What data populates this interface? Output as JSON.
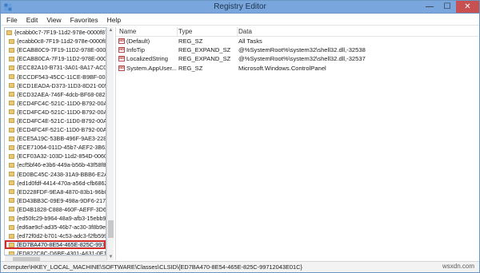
{
  "window": {
    "title": "Registry Editor"
  },
  "controls": {
    "minimize": "—",
    "maximize": "☐",
    "close": "✕"
  },
  "menu": [
    "File",
    "Edit",
    "View",
    "Favorites",
    "Help"
  ],
  "tree": {
    "items": [
      "{ecabb0c7-7F19-11d2-978e-0000f87",
      "{ecabb0c8-7F19-11d2-978e-0000f87",
      "{ECABB0C9-7F19-11D2-978E-0000F",
      "{ECABB0CA-7F19-11D2-978E-0000F",
      "{ECC82A10-B731-3A01-8A17-AC0D",
      "{ECCDF543-45CC-11CE-B9BF-0080",
      "{ECD1EADA-D373-11D3-8D21-0050",
      "{ECD32AEA-746F-4dcb-BF68-08275",
      "{ECD4FC4C-521C-11D0-B792-00A0",
      "{ECD4FC4D-521C-11D0-B792-00A0",
      "{ECD4FC4E-521C-11D0-B792-00A0",
      "{ECD4FC4F-521C-11D0-B792-00A0",
      "{ECE5A19C-53BB-496F-9AE3-2283F",
      "{ECE71064-011D-45b7-AEF2-3B626",
      "{ECF03A32-103D-11d2-854D-00600",
      "{ecf5bf46-e3b6-449a-b56b-43f58f8",
      "{ED0BC45C-2438-31A9-BBB6-E2A3",
      "{ed1d0fdf-4414-470a-a56d-cfb6862",
      "{ED228FDF-9EA8-4870-83b1-96b02",
      "{ED43BB3C-09E9-498a-9DF6-21772",
      "{ED4B1828-C888-460F-AEFF-3D63F",
      "{ed50fc29-b964-48a9-afb3-15ebb9f",
      "{ed6ae9cf-ad35-46b7-ac30-3f8b9e8",
      "{ed72f0d2-b701-4c53-adc3-f2fb599",
      "{ED7BA470-8E54-465E-825C-99712",
      "{ED822C8C-D6BE-4301-A631-0E141"
    ],
    "selected_index": 24
  },
  "list": {
    "headers": {
      "name": "Name",
      "type": "Type",
      "data": "Data"
    },
    "rows": [
      {
        "name": "(Default)",
        "type": "REG_SZ",
        "data": "All Tasks"
      },
      {
        "name": "InfoTip",
        "type": "REG_EXPAND_SZ",
        "data": "@%SystemRoot%\\system32\\shell32.dll,-32538"
      },
      {
        "name": "LocalizedString",
        "type": "REG_EXPAND_SZ",
        "data": "@%SystemRoot%\\system32\\shell32.dll,-32537"
      },
      {
        "name": "System.AppUser...",
        "type": "REG_SZ",
        "data": "Microsoft.Windows.ControlPanel"
      }
    ],
    "value_icon_text": "ab"
  },
  "statusbar": {
    "path": "Computer\\HKEY_LOCAL_MACHINE\\SOFTWARE\\Classes\\CLSID\\{ED7BA470-8E54-465E-825C-99712043E01C}"
  },
  "watermark": "wsxdn.com",
  "colors": {
    "titlebar": "#79a6dc",
    "close_button": "#c75050",
    "selection_outline": "#d32a2a",
    "folder": "#e9c874"
  }
}
